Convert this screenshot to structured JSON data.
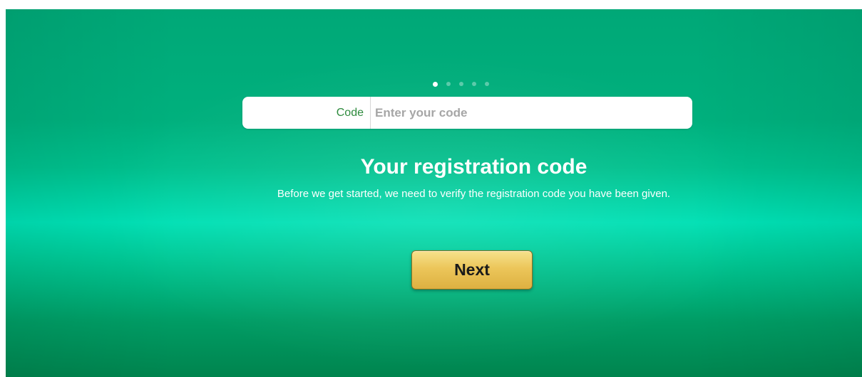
{
  "pagination": {
    "total_steps": 5,
    "current_step": 1
  },
  "code_field": {
    "label": "Code",
    "placeholder": "Enter your code",
    "value": ""
  },
  "heading": {
    "title": "Your registration code",
    "subtitle": "Before we get started, we need to verify the registration code you have been given."
  },
  "actions": {
    "next_label": "Next"
  },
  "colors": {
    "background_green": "#00b07d",
    "label_green": "#2e8b3e",
    "button_gold": "#ecc65a"
  }
}
